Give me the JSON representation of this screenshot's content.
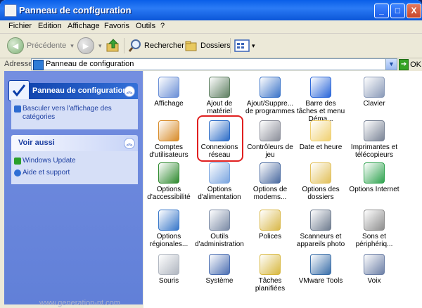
{
  "window": {
    "title": "Panneau de configuration",
    "minimize": "_",
    "maximize": "□",
    "close": "X"
  },
  "menu": [
    "Fichier",
    "Edition",
    "Affichage",
    "Favoris",
    "Outils",
    "?"
  ],
  "toolbar": {
    "back": "Précédente",
    "search": "Rechercher",
    "folders": "Dossiers"
  },
  "address": {
    "label": "Adresse",
    "value": "Panneau de configuration",
    "go": "OK"
  },
  "left_pane": {
    "main_title": "Panneau de configuration",
    "main_links": [
      "Basculer vers l'affichage des catégories"
    ],
    "other_title": "Voir aussi",
    "other_links": [
      "Windows Update",
      "Aide et support"
    ]
  },
  "items": [
    {
      "label": "Affichage",
      "icon": "display-icon",
      "color": "#6a8fd6"
    },
    {
      "label": "Ajout de matériel",
      "icon": "hardware-icon",
      "color": "#5e7f61"
    },
    {
      "label": "Ajout/Suppre... de programmes",
      "icon": "programs-icon",
      "color": "#3b74c8"
    },
    {
      "label": "Barre des tâches et menu Déma...",
      "icon": "taskbar-icon",
      "color": "#2a66d9"
    },
    {
      "label": "Clavier",
      "icon": "keyboard-icon",
      "color": "#8a9ab8"
    },
    {
      "label": "Comptes d'utilisateurs",
      "icon": "users-icon",
      "color": "#d88c2a"
    },
    {
      "label": "Connexions réseau",
      "icon": "network-icon",
      "color": "#2c6cc7"
    },
    {
      "label": "Contrôleurs de jeu",
      "icon": "gamepad-icon",
      "color": "#8c8f9a"
    },
    {
      "label": "Date et heure",
      "icon": "clock-icon",
      "color": "#f0d070"
    },
    {
      "label": "Imprimantes et télécopieurs",
      "icon": "printer-icon",
      "color": "#7a8496"
    },
    {
      "label": "Options d'accessibilité",
      "icon": "accessibility-icon",
      "color": "#2f8a2f"
    },
    {
      "label": "Options d'alimentation",
      "icon": "power-icon",
      "color": "#7aa5e0"
    },
    {
      "label": "Options de modems...",
      "icon": "modem-icon",
      "color": "#4a6aa0"
    },
    {
      "label": "Options des dossiers",
      "icon": "folder-options-icon",
      "color": "#e2c05a"
    },
    {
      "label": "Options Internet",
      "icon": "internet-icon",
      "color": "#2fa34f"
    },
    {
      "label": "Options régionales...",
      "icon": "regional-icon",
      "color": "#3877c9"
    },
    {
      "label": "Outils d'administration",
      "icon": "admin-tools-icon",
      "color": "#7a8aa5"
    },
    {
      "label": "Polices",
      "icon": "fonts-icon",
      "color": "#d9b84a"
    },
    {
      "label": "Scanneurs et appareils photo",
      "icon": "scanner-icon",
      "color": "#6f7c8f"
    },
    {
      "label": "Sons et périphériq...",
      "icon": "sound-icon",
      "color": "#8e8e8e"
    },
    {
      "label": "Souris",
      "icon": "mouse-icon",
      "color": "#b0b6c0"
    },
    {
      "label": "Système",
      "icon": "system-icon",
      "color": "#4c6fb2"
    },
    {
      "label": "Tâches planifiées",
      "icon": "scheduled-tasks-icon",
      "color": "#d8b840"
    },
    {
      "label": "VMware Tools",
      "icon": "vmware-icon",
      "color": "#3a6ea8"
    },
    {
      "label": "Voix",
      "icon": "speech-icon",
      "color": "#6c7fa6"
    }
  ],
  "highlighted_item": "Connexions réseau",
  "watermark": "www.generation-nt.com",
  "colors": {
    "titlebar": "#0a5fe8",
    "left_pane": "#6a86dc",
    "highlight": "#e02020"
  }
}
